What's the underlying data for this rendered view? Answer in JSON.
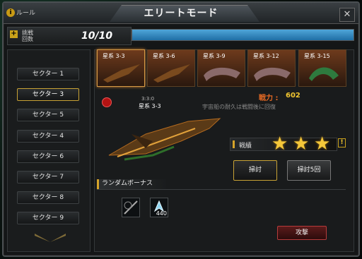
{
  "header": {
    "title": "エリートモード",
    "rules_label": "ルール",
    "rules_icon": "info-icon",
    "close_label": "✕"
  },
  "challenge": {
    "label_line1": "挑戦",
    "label_line2": "回数",
    "value": "10/10",
    "progress_fraction": 1.0
  },
  "sectors": [
    {
      "label": "セクター 1",
      "active": false
    },
    {
      "label": "セクター 3",
      "active": true
    },
    {
      "label": "セクター 5",
      "active": false
    },
    {
      "label": "セクター 4",
      "active": false
    },
    {
      "label": "セクター 6",
      "active": false
    },
    {
      "label": "セクター 7",
      "active": false
    },
    {
      "label": "セクター 8",
      "active": false
    },
    {
      "label": "セクター 9",
      "active": false
    }
  ],
  "stages": [
    {
      "label": "星系 3-3",
      "selected": true
    },
    {
      "label": "星系 3-6",
      "selected": false
    },
    {
      "label": "星系 3-9",
      "selected": false
    },
    {
      "label": "星系 3-12",
      "selected": false
    },
    {
      "label": "星系 3-15",
      "selected": false
    }
  ],
  "detail": {
    "tag": "3:3:0",
    "name": "星系 3-3",
    "power_label": "戦力 :",
    "power_value": "602",
    "hint": "宇宙船の耐久は戦闘後に回復",
    "rating_label": "戦績",
    "stars": 3,
    "sweep_label": "掃討",
    "sweep5_label": "掃討5回",
    "attack_label": "攻撃"
  },
  "bonus": {
    "title": "ランダムボーナス",
    "items": [
      {
        "icon": "gear-part-icon",
        "qty": ""
      },
      {
        "icon": "crystal-icon",
        "qty": "440"
      }
    ]
  },
  "colors": {
    "accent_gold": "#d6a42a",
    "power_label": "#e86a23",
    "power_value": "#f2c630",
    "progress_blue": "#3a8fc7",
    "attack_red": "#5a1b1b"
  }
}
